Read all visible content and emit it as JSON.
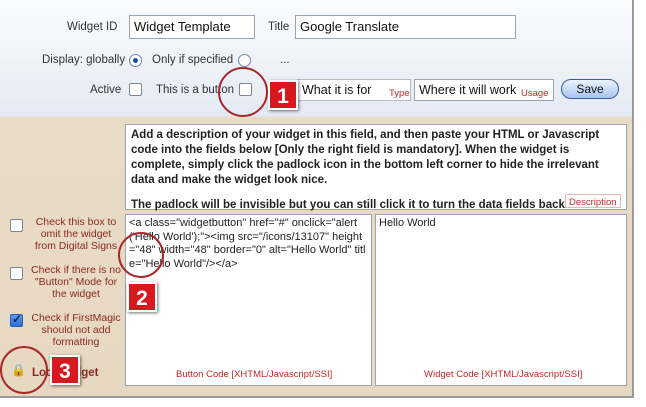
{
  "form": {
    "widget_id_label": "Widget ID",
    "widget_id_value": "Widget Template",
    "title_label": "Title",
    "title_value": "Google Translate",
    "display_label": "Display: globally",
    "only_if_specified_label": "Only if specified",
    "ellipsis": "...",
    "active_label": "Active",
    "is_button_label": "This is a button",
    "what_it_is_for_value": "What it is for",
    "type_tag": "Type",
    "where_value": "Where it will work",
    "usage_tag": "Usage",
    "save_label": "Save",
    "display_selected": "globally"
  },
  "description": {
    "line1": "Add a description of your widget in this field, and then paste your HTML or Javascript code into the fields below [Only the right field is mandatory]. When the widget is complete, simply click the padlock icon in the bottom left corner to hide the irrelevant data and make the widget look nice.",
    "line2": "The padlock will be invisible but you can still click it to turn the data fields back o",
    "tag": "Description"
  },
  "code": {
    "button_code": "<a class=\"widgetbutton\" href=\"#\" onclick=\"alert('Hello World');\"><img src=\"/icons/13107\" height=\"48\" width=\"48\" border=\"0\" alt=\"Hello World\" title=\"Hello World\"/></a>",
    "button_code_tag": "Button Code [XHTML/Javascript/SSI]",
    "widget_code": "Hello World",
    "widget_code_tag": "Widget Code [XHTML/Javascript/SSI]"
  },
  "sidebar": {
    "omit_label": "Check this box to omit the widget from Digital Signs",
    "no_button_label": "Check if there is no \"Button\" Mode for the widget",
    "no_formatting_label": "Check if FirstMagic should not add formatting",
    "lock_label": "Lock widget",
    "omit_checked": false,
    "no_button_checked": false,
    "no_formatting_checked": true
  },
  "callouts": {
    "one": "1",
    "two": "2",
    "three": "3"
  },
  "colors": {
    "accent_red": "#d7191f",
    "tag_red": "#c0282a",
    "save_blue": "#a9c4ee"
  }
}
